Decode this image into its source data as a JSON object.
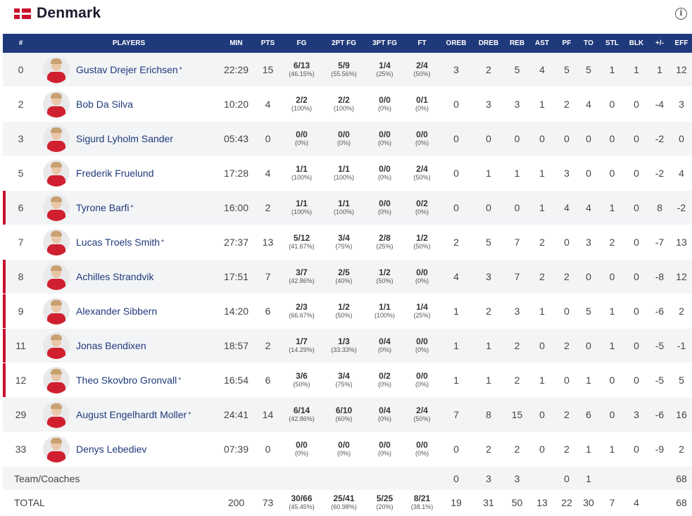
{
  "team": {
    "name": "Denmark",
    "flag_colors": {
      "red": "#c8102e",
      "white": "#ffffff"
    }
  },
  "icons": {
    "info": "info-icon",
    "flag": "denmark-flag-icon"
  },
  "info_glyph": "i",
  "columns": [
    "#",
    "PLAYERS",
    "MIN",
    "PTS",
    "FG",
    "2PT FG",
    "3PT FG",
    "FT",
    "OREB",
    "DREB",
    "REB",
    "AST",
    "PF",
    "TO",
    "STL",
    "BLK",
    "+/-",
    "EFF"
  ],
  "players": [
    {
      "num": "0",
      "name": "Gustav Drejer Erichsen",
      "starter": true,
      "marked": false,
      "min": "22:29",
      "pts": "15",
      "fg": "6/13",
      "fg_pct": "(46.15%)",
      "fg2": "5/9",
      "fg2_pct": "(55.56%)",
      "fg3": "1/4",
      "fg3_pct": "(25%)",
      "ft": "2/4",
      "ft_pct": "(50%)",
      "oreb": "3",
      "dreb": "2",
      "reb": "5",
      "ast": "4",
      "pf": "5",
      "to": "5",
      "stl": "1",
      "blk": "1",
      "pm": "1",
      "eff": "12"
    },
    {
      "num": "2",
      "name": "Bob Da Silva",
      "starter": false,
      "marked": false,
      "min": "10:20",
      "pts": "4",
      "fg": "2/2",
      "fg_pct": "(100%)",
      "fg2": "2/2",
      "fg2_pct": "(100%)",
      "fg3": "0/0",
      "fg3_pct": "(0%)",
      "ft": "0/1",
      "ft_pct": "(0%)",
      "oreb": "0",
      "dreb": "3",
      "reb": "3",
      "ast": "1",
      "pf": "2",
      "to": "4",
      "stl": "0",
      "blk": "0",
      "pm": "-4",
      "eff": "3"
    },
    {
      "num": "3",
      "name": "Sigurd Lyholm Sander",
      "starter": false,
      "marked": false,
      "min": "05:43",
      "pts": "0",
      "fg": "0/0",
      "fg_pct": "(0%)",
      "fg2": "0/0",
      "fg2_pct": "(0%)",
      "fg3": "0/0",
      "fg3_pct": "(0%)",
      "ft": "0/0",
      "ft_pct": "(0%)",
      "oreb": "0",
      "dreb": "0",
      "reb": "0",
      "ast": "0",
      "pf": "0",
      "to": "0",
      "stl": "0",
      "blk": "0",
      "pm": "-2",
      "eff": "0"
    },
    {
      "num": "5",
      "name": "Frederik Fruelund",
      "starter": false,
      "marked": false,
      "min": "17:28",
      "pts": "4",
      "fg": "1/1",
      "fg_pct": "(100%)",
      "fg2": "1/1",
      "fg2_pct": "(100%)",
      "fg3": "0/0",
      "fg3_pct": "(0%)",
      "ft": "2/4",
      "ft_pct": "(50%)",
      "oreb": "0",
      "dreb": "1",
      "reb": "1",
      "ast": "1",
      "pf": "3",
      "to": "0",
      "stl": "0",
      "blk": "0",
      "pm": "-2",
      "eff": "4"
    },
    {
      "num": "6",
      "name": "Tyrone Barfi",
      "starter": true,
      "marked": true,
      "min": "16:00",
      "pts": "2",
      "fg": "1/1",
      "fg_pct": "(100%)",
      "fg2": "1/1",
      "fg2_pct": "(100%)",
      "fg3": "0/0",
      "fg3_pct": "(0%)",
      "ft": "0/2",
      "ft_pct": "(0%)",
      "oreb": "0",
      "dreb": "0",
      "reb": "0",
      "ast": "1",
      "pf": "4",
      "to": "4",
      "stl": "1",
      "blk": "0",
      "pm": "8",
      "eff": "-2"
    },
    {
      "num": "7",
      "name": "Lucas Troels Smith",
      "starter": true,
      "marked": false,
      "min": "27:37",
      "pts": "13",
      "fg": "5/12",
      "fg_pct": "(41.67%)",
      "fg2": "3/4",
      "fg2_pct": "(75%)",
      "fg3": "2/8",
      "fg3_pct": "(25%)",
      "ft": "1/2",
      "ft_pct": "(50%)",
      "oreb": "2",
      "dreb": "5",
      "reb": "7",
      "ast": "2",
      "pf": "0",
      "to": "3",
      "stl": "2",
      "blk": "0",
      "pm": "-7",
      "eff": "13"
    },
    {
      "num": "8",
      "name": "Achilles Strandvik",
      "starter": false,
      "marked": true,
      "min": "17:51",
      "pts": "7",
      "fg": "3/7",
      "fg_pct": "(42.86%)",
      "fg2": "2/5",
      "fg2_pct": "(40%)",
      "fg3": "1/2",
      "fg3_pct": "(50%)",
      "ft": "0/0",
      "ft_pct": "(0%)",
      "oreb": "4",
      "dreb": "3",
      "reb": "7",
      "ast": "2",
      "pf": "2",
      "to": "0",
      "stl": "0",
      "blk": "0",
      "pm": "-8",
      "eff": "12"
    },
    {
      "num": "9",
      "name": "Alexander Sibbern",
      "starter": false,
      "marked": true,
      "min": "14:20",
      "pts": "6",
      "fg": "2/3",
      "fg_pct": "(66.67%)",
      "fg2": "1/2",
      "fg2_pct": "(50%)",
      "fg3": "1/1",
      "fg3_pct": "(100%)",
      "ft": "1/4",
      "ft_pct": "(25%)",
      "oreb": "1",
      "dreb": "2",
      "reb": "3",
      "ast": "1",
      "pf": "0",
      "to": "5",
      "stl": "1",
      "blk": "0",
      "pm": "-6",
      "eff": "2"
    },
    {
      "num": "11",
      "name": "Jonas Bendixen",
      "starter": false,
      "marked": true,
      "min": "18:57",
      "pts": "2",
      "fg": "1/7",
      "fg_pct": "(14.29%)",
      "fg2": "1/3",
      "fg2_pct": "(33.33%)",
      "fg3": "0/4",
      "fg3_pct": "(0%)",
      "ft": "0/0",
      "ft_pct": "(0%)",
      "oreb": "1",
      "dreb": "1",
      "reb": "2",
      "ast": "0",
      "pf": "2",
      "to": "0",
      "stl": "1",
      "blk": "0",
      "pm": "-5",
      "eff": "-1"
    },
    {
      "num": "12",
      "name": "Theo Skovbro Gronvall",
      "starter": true,
      "marked": true,
      "min": "16:54",
      "pts": "6",
      "fg": "3/6",
      "fg_pct": "(50%)",
      "fg2": "3/4",
      "fg2_pct": "(75%)",
      "fg3": "0/2",
      "fg3_pct": "(0%)",
      "ft": "0/0",
      "ft_pct": "(0%)",
      "oreb": "1",
      "dreb": "1",
      "reb": "2",
      "ast": "1",
      "pf": "0",
      "to": "1",
      "stl": "0",
      "blk": "0",
      "pm": "-5",
      "eff": "5"
    },
    {
      "num": "29",
      "name": "August Engelhardt Moller",
      "starter": true,
      "marked": false,
      "min": "24:41",
      "pts": "14",
      "fg": "6/14",
      "fg_pct": "(42.86%)",
      "fg2": "6/10",
      "fg2_pct": "(60%)",
      "fg3": "0/4",
      "fg3_pct": "(0%)",
      "ft": "2/4",
      "ft_pct": "(50%)",
      "oreb": "7",
      "dreb": "8",
      "reb": "15",
      "ast": "0",
      "pf": "2",
      "to": "6",
      "stl": "0",
      "blk": "3",
      "pm": "-6",
      "eff": "16"
    },
    {
      "num": "33",
      "name": "Denys Lebediev",
      "starter": false,
      "marked": false,
      "min": "07:39",
      "pts": "0",
      "fg": "0/0",
      "fg_pct": "(0%)",
      "fg2": "0/0",
      "fg2_pct": "(0%)",
      "fg3": "0/0",
      "fg3_pct": "(0%)",
      "ft": "0/0",
      "ft_pct": "(0%)",
      "oreb": "0",
      "dreb": "2",
      "reb": "2",
      "ast": "0",
      "pf": "2",
      "to": "1",
      "stl": "1",
      "blk": "0",
      "pm": "-9",
      "eff": "2"
    }
  ],
  "team_coaches": {
    "label": "Team/Coaches",
    "oreb": "0",
    "dreb": "3",
    "reb": "3",
    "pf": "0",
    "to": "1",
    "eff": "68"
  },
  "totals": {
    "label": "TOTAL",
    "min": "200",
    "pts": "73",
    "fg": "30/66",
    "fg_pct": "(45.45%)",
    "fg2": "25/41",
    "fg2_pct": "(60.98%)",
    "fg3": "5/25",
    "fg3_pct": "(20%)",
    "ft": "8/21",
    "ft_pct": "(38.1%)",
    "oreb": "19",
    "dreb": "31",
    "reb": "50",
    "ast": "13",
    "pf": "22",
    "to": "30",
    "stl": "7",
    "blk": "4",
    "eff": "68"
  },
  "starter_mark": "*"
}
